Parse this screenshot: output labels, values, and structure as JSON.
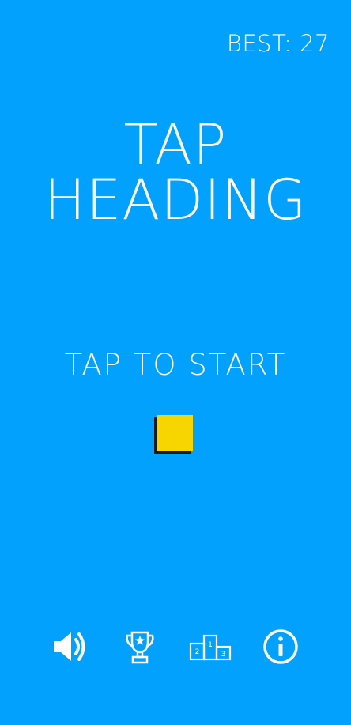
{
  "header": {
    "best_label": "BEST: 27"
  },
  "title": {
    "line1": "TAP",
    "line2": "HEADING"
  },
  "prompt": {
    "start_label": "TAP TO START"
  },
  "colors": {
    "background": "#03a1fe",
    "player": "#f7d501",
    "text": "#ffffff"
  },
  "toolbar": {
    "sound_icon": "speaker-icon",
    "trophy_icon": "trophy-icon",
    "podium_icon": "podium-icon",
    "podium_ranks": [
      "1",
      "2",
      "3"
    ],
    "info_icon": "info-icon"
  }
}
